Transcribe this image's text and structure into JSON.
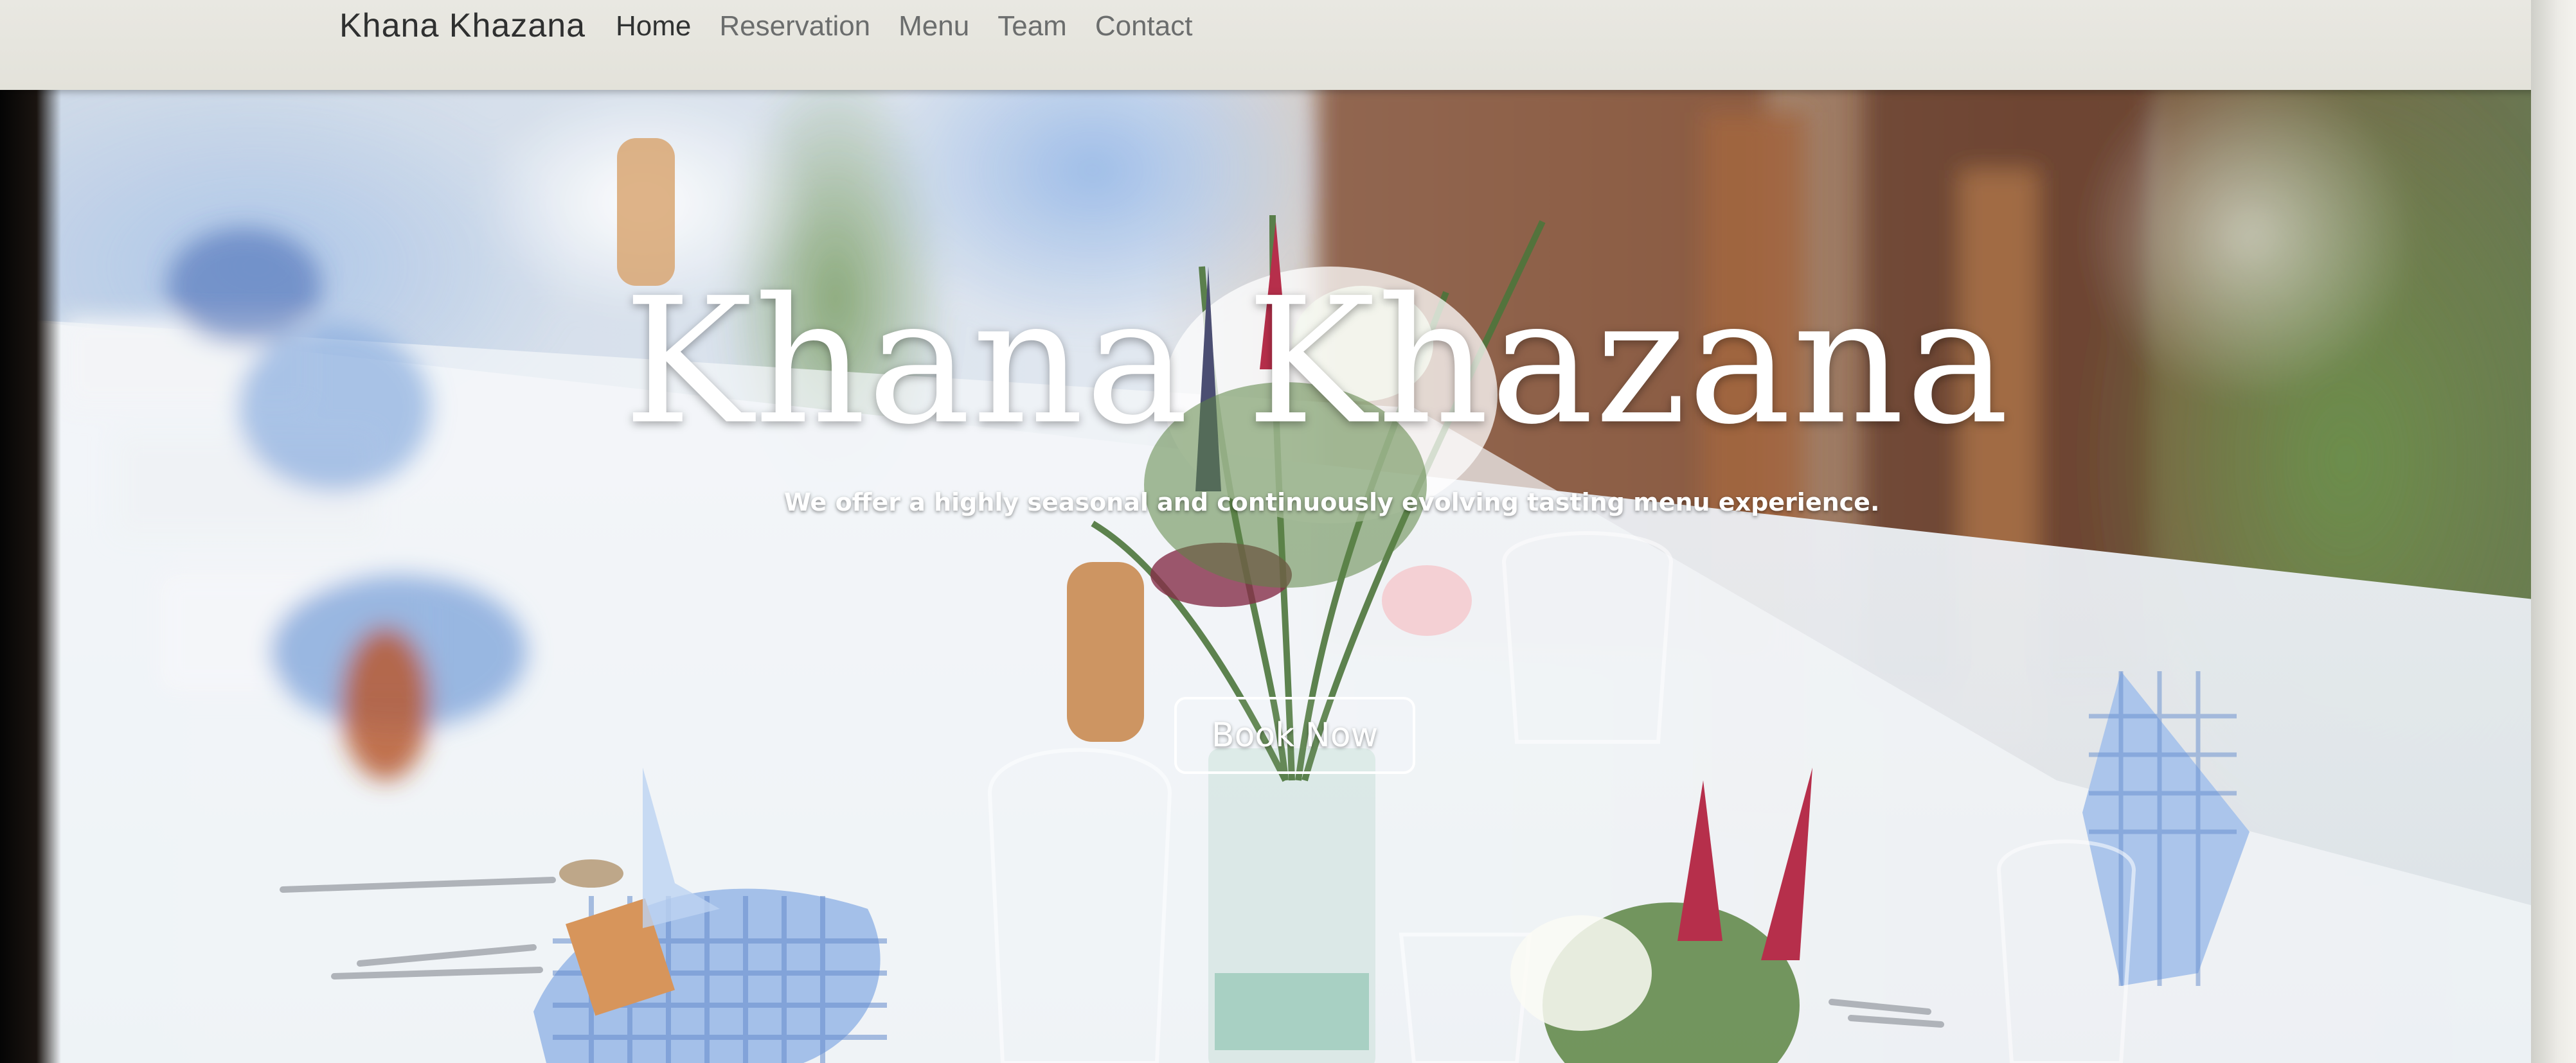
{
  "navbar": {
    "brand": "Khana Khazana",
    "links": [
      {
        "label": "Home",
        "active": true
      },
      {
        "label": "Reservation",
        "active": false
      },
      {
        "label": "Menu",
        "active": false
      },
      {
        "label": "Team",
        "active": false
      },
      {
        "label": "Contact",
        "active": false
      }
    ]
  },
  "hero": {
    "title": "Khana Khazana",
    "subtitle": "We offer a highly seasonal and continuously evolving tasting menu experience.",
    "cta_label": "Book Now"
  },
  "colors": {
    "navbar_bg": "#e6e5de",
    "brand_text": "#2f3030",
    "nav_text": "#6b6d6d",
    "hero_text": "#ffffff"
  }
}
